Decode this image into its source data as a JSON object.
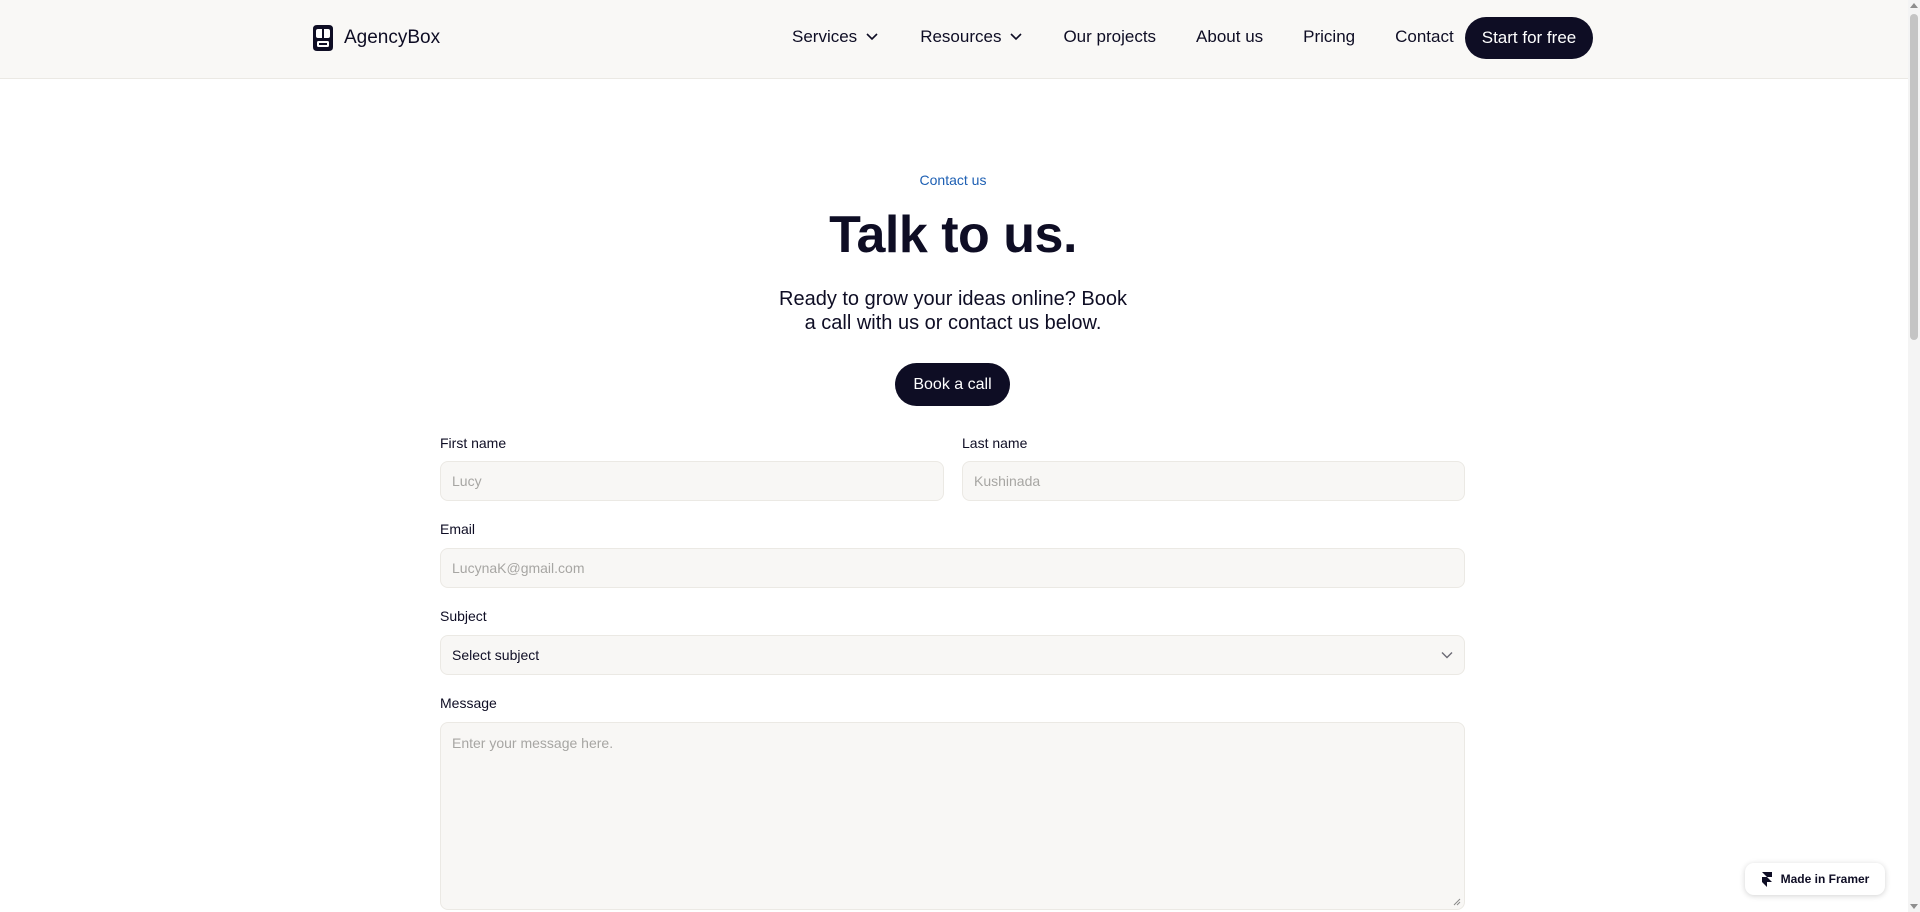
{
  "nav": {
    "brand": "AgencyBox",
    "links": [
      {
        "label": "Services",
        "dropdown": true
      },
      {
        "label": "Resources",
        "dropdown": true
      },
      {
        "label": "Our projects",
        "dropdown": false
      },
      {
        "label": "About us",
        "dropdown": false
      },
      {
        "label": "Pricing",
        "dropdown": false
      },
      {
        "label": "Contact",
        "dropdown": false
      }
    ],
    "cta": "Start for free"
  },
  "hero": {
    "eyebrow": "Contact us",
    "title": "Talk to us.",
    "subtitle": "Ready to grow your ideas online? Book a call with us or contact us below.",
    "cta": "Book a call"
  },
  "form": {
    "first_name": {
      "label": "First name",
      "placeholder": "Lucy"
    },
    "last_name": {
      "label": "Last name",
      "placeholder": "Kushinada"
    },
    "email": {
      "label": "Email",
      "placeholder": "LucynaK@gmail.com"
    },
    "subject": {
      "label": "Subject",
      "value": "Select subject"
    },
    "message": {
      "label": "Message",
      "placeholder": "Enter your message here."
    }
  },
  "badge": {
    "label": "Made in Framer",
    "icon": "framer-icon"
  },
  "icons": {
    "logo": "robot-logo-icon",
    "dropdown": "chevron-down-icon"
  },
  "colors": {
    "ink": "#0e0d24",
    "accent": "#1d5fb3",
    "nav_bg": "#f9f8f6",
    "field_bg": "#f8f7f5"
  }
}
